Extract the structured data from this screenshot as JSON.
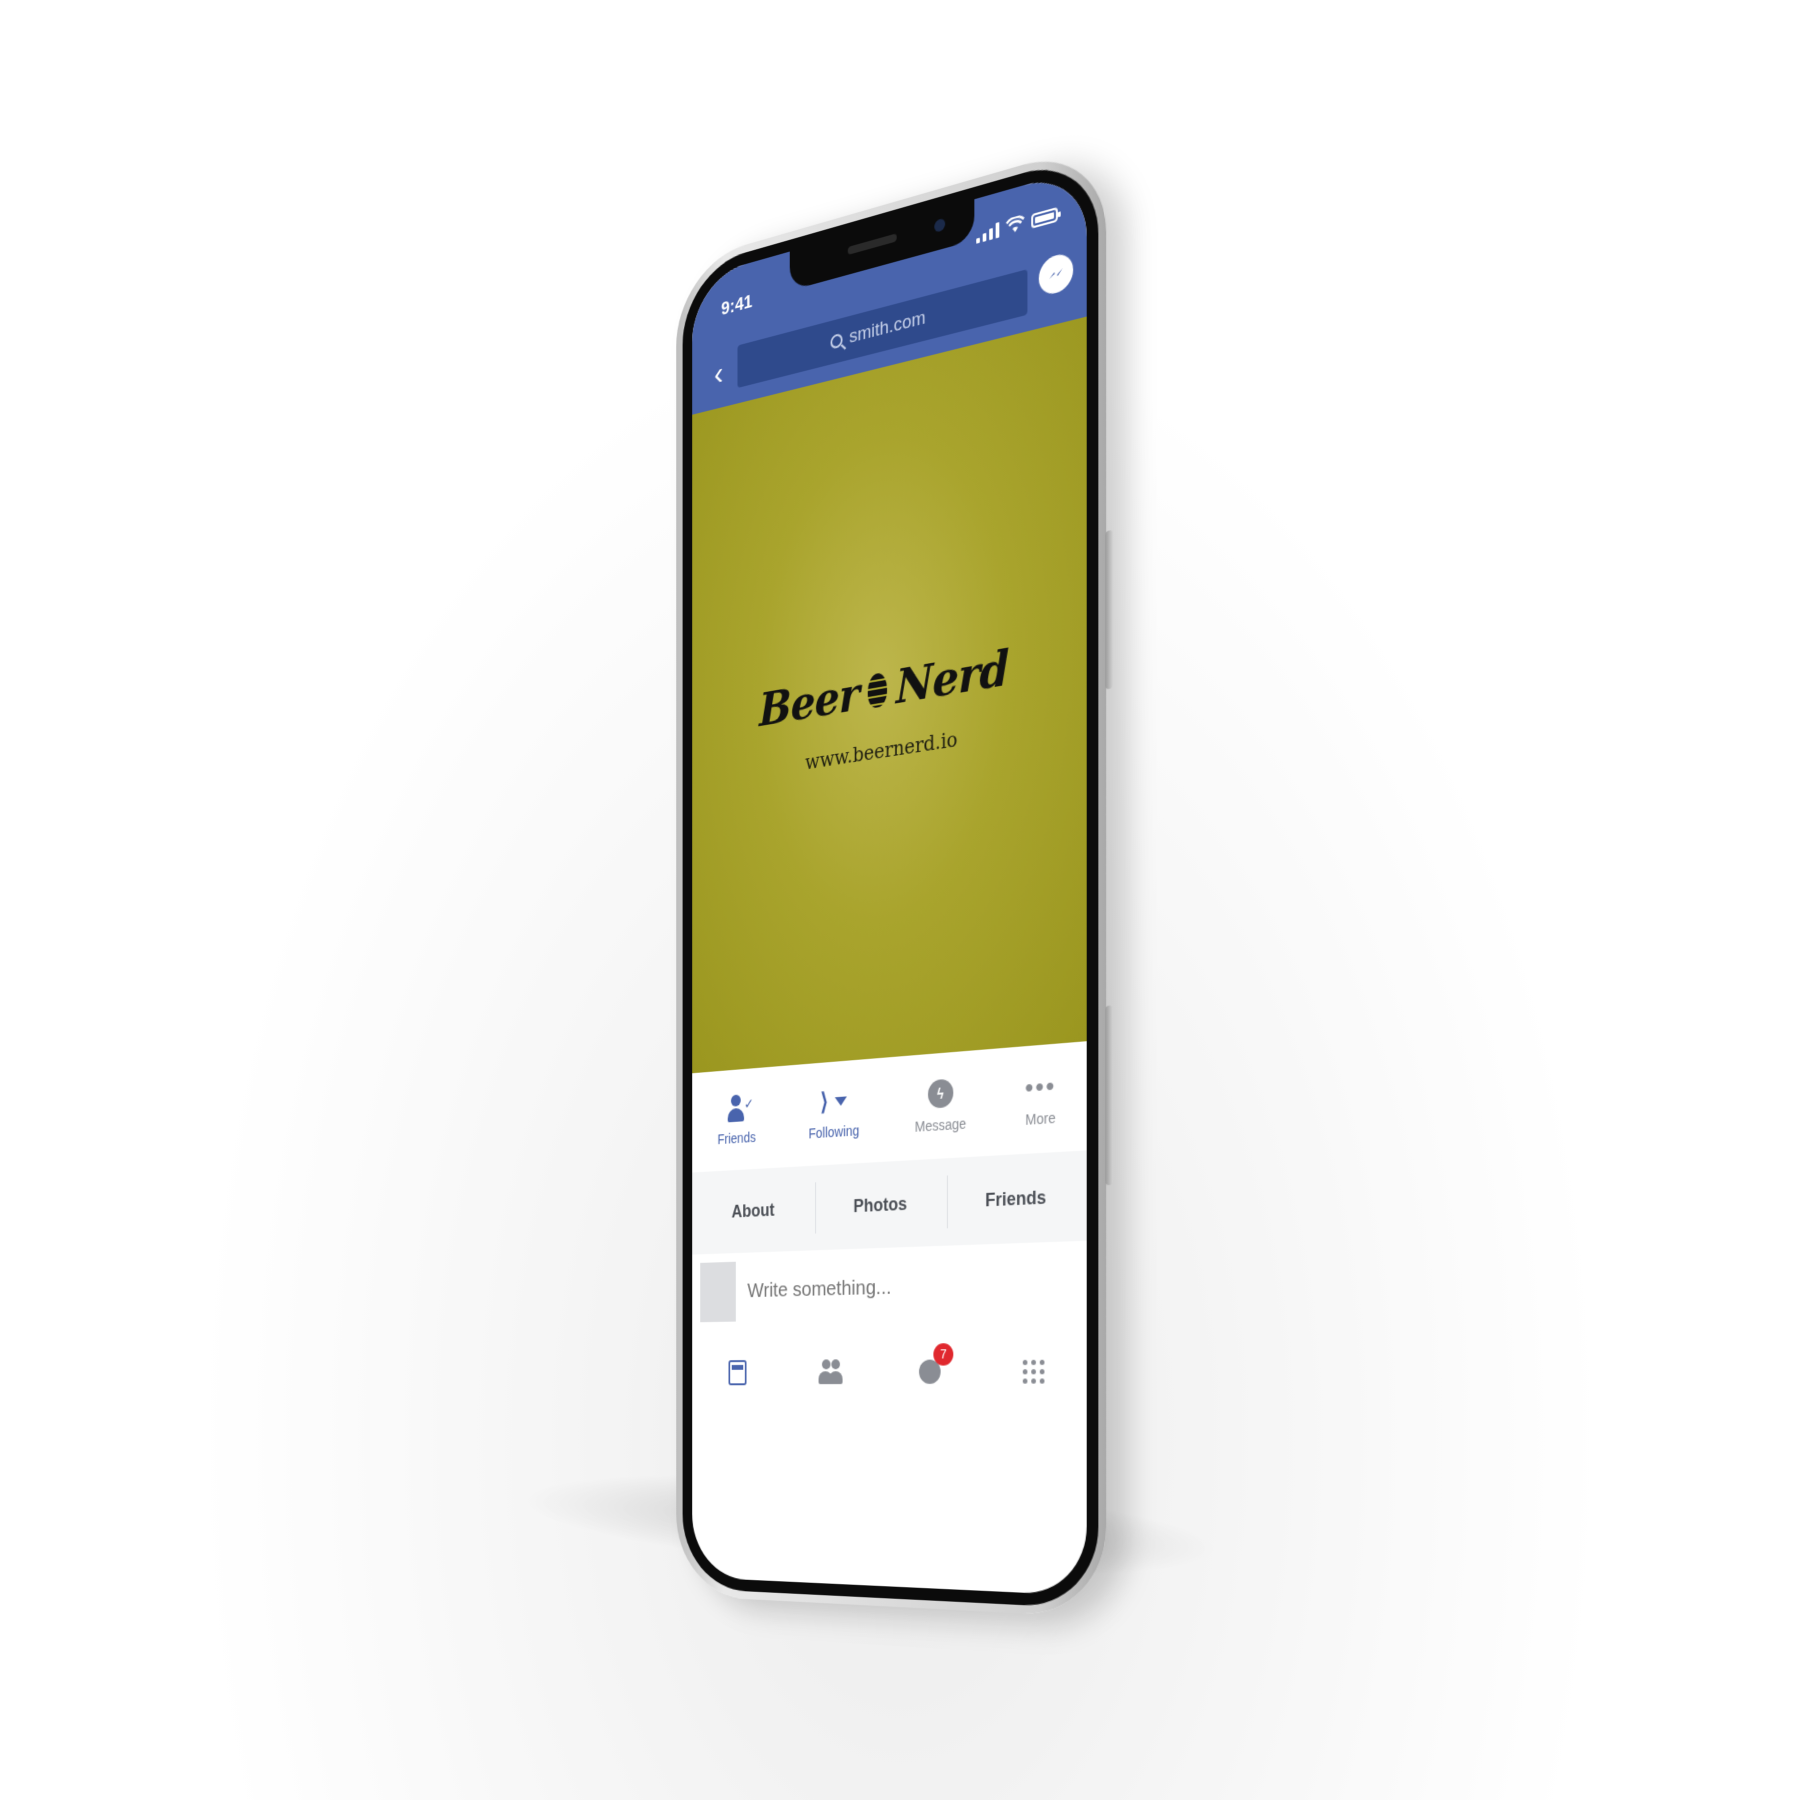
{
  "status": {
    "time": "9:41"
  },
  "header": {
    "url": "smith.com"
  },
  "cover": {
    "brand_left": "Beer",
    "brand_right": "Nerd",
    "website": "www.beernerd.io"
  },
  "actions": [
    {
      "label": "Friends",
      "icon": "friend-check-icon"
    },
    {
      "label": "Following",
      "icon": "rss-icon"
    },
    {
      "label": "Message",
      "icon": "messenger-icon"
    },
    {
      "label": "More",
      "icon": "more-dots-icon"
    }
  ],
  "tabs": [
    {
      "label": "About"
    },
    {
      "label": "Photos"
    },
    {
      "label": "Friends"
    }
  ],
  "composer": {
    "placeholder": "Write something..."
  },
  "bottom_nav": {
    "notifications_count": "7"
  },
  "colors": {
    "brand_blue": "#4964ad",
    "cover_olive": "#a9a42d",
    "badge_red": "#e0282e"
  }
}
